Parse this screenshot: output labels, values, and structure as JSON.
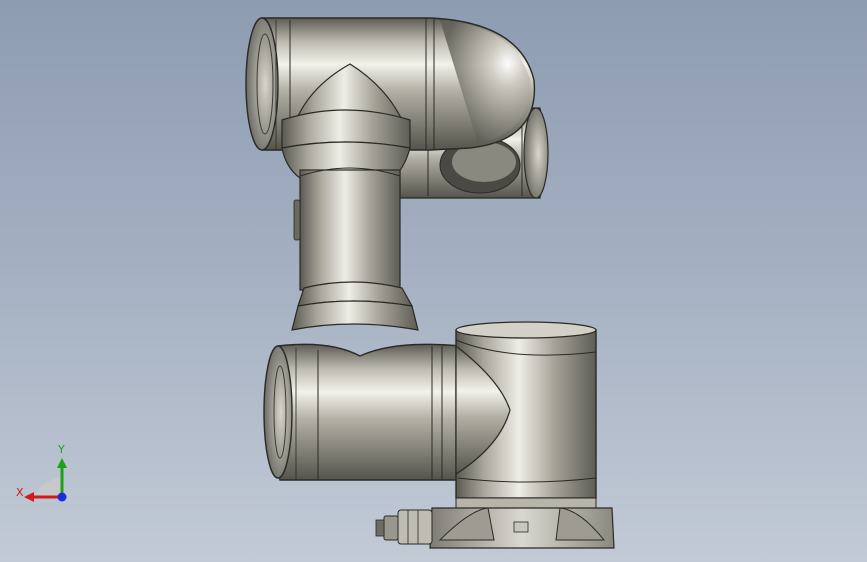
{
  "viewport": {
    "background_top": "#8e9cb1",
    "background_bottom": "#c2cad6"
  },
  "triad": {
    "x_label": "X",
    "y_label": "Y",
    "x_color": "#d11b1b",
    "y_color": "#19a319",
    "z_color": "#1a2fd8"
  },
  "model": {
    "name_icon": "robot-arm-model",
    "material_color": "#a9a79b",
    "parts": [
      "base",
      "shoulder-joint",
      "upper-arm-link",
      "elbow-joint",
      "forearm-link",
      "wrist-joint",
      "cable-connector"
    ]
  }
}
